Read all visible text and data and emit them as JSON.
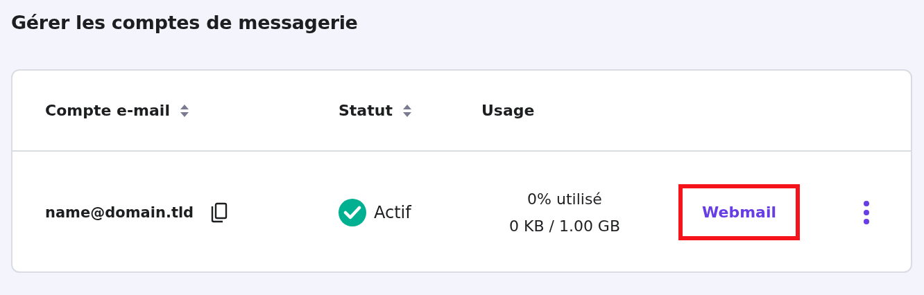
{
  "title": "Gérer les comptes de messagerie",
  "table": {
    "columns": [
      {
        "label": "Compte e-mail",
        "sortable": true
      },
      {
        "label": "Statut",
        "sortable": true
      },
      {
        "label": "Usage",
        "sortable": false
      }
    ],
    "rows": [
      {
        "email": "name@domain.tld",
        "status": {
          "kind": "active",
          "label": "Actif"
        },
        "usage": [
          "0% utilisé",
          "0 KB / 1.00 GB"
        ],
        "action": {
          "label": "Webmail",
          "highlighted": true
        }
      }
    ]
  }
}
